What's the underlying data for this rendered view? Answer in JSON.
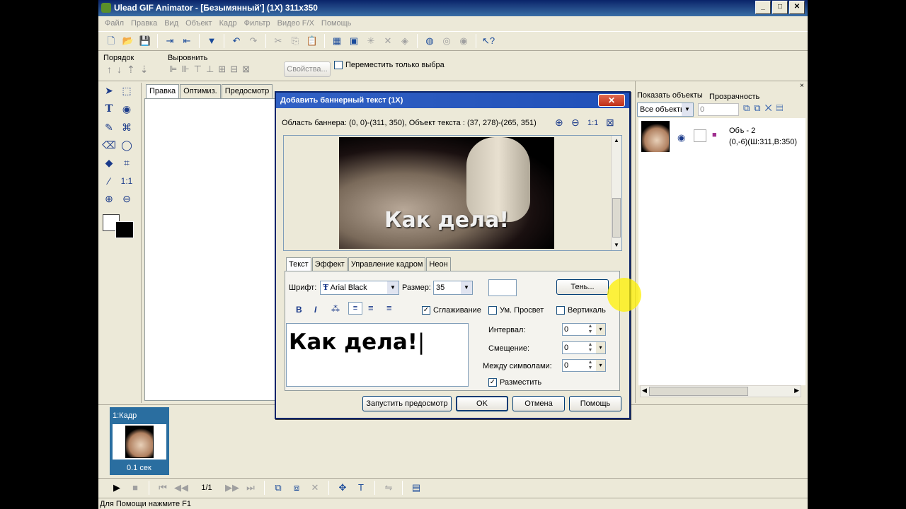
{
  "window": {
    "title": "Ulead GIF Animator - [Безымянный'] (1X) 311x350"
  },
  "menu": [
    "Файл",
    "Правка",
    "Вид",
    "Объект",
    "Кадр",
    "Фильтр",
    "Видео F/X",
    "Помощь"
  ],
  "toolbar2": {
    "order_label": "Порядок",
    "align_label": "Выровнить",
    "properties_button": "Свойства...",
    "move_only_label": "Переместить только выбра"
  },
  "editor_tabs": [
    "Правка",
    "Оптимиз.",
    "Предосмотр"
  ],
  "objects_panel": {
    "show_objects_label": "Показать объекты",
    "transparency_label": "Прозрачность",
    "filter_value": "Все объекты",
    "transparency_value": "0",
    "object": {
      "name": "Объ - 2",
      "info": "(0,-6)(Ш:311,В:350)"
    }
  },
  "frames": {
    "frame_label": "1:Кадр",
    "frame_delay": "0.1 сек",
    "counter": "1/1"
  },
  "status": "Для Помощи нажмите F1",
  "dialog": {
    "title": "Добавить баннерный текст (1X)",
    "area_info": "Область баннера: (0, 0)-(311, 350), Объект текста : (37, 278)-(265, 351)",
    "zoom_label": "1:1",
    "preview_text": "Как дела!",
    "tabs": [
      "Текст",
      "Эффект",
      "Управление кадром",
      "Неон"
    ],
    "font_label": "Шрифт:",
    "font_value": "Arial Black",
    "size_label": "Размер:",
    "size_value": "35",
    "shadow_button": "Тень...",
    "smoothing_label": "Сглаживание",
    "smart_label": "Ум. Просвет",
    "vertical_label": "Вертикаль",
    "text_value": "Как дела!",
    "interval_label": "Интервал:",
    "interval_value": "0",
    "offset_label": "Смещение:",
    "offset_value": "0",
    "spacing_label": "Между символами:",
    "spacing_value": "0",
    "place_label": "Разместить",
    "preview_button": "Запустить предосмотр",
    "ok_button": "OK",
    "cancel_button": "Отмена",
    "help_button": "Помощь"
  }
}
